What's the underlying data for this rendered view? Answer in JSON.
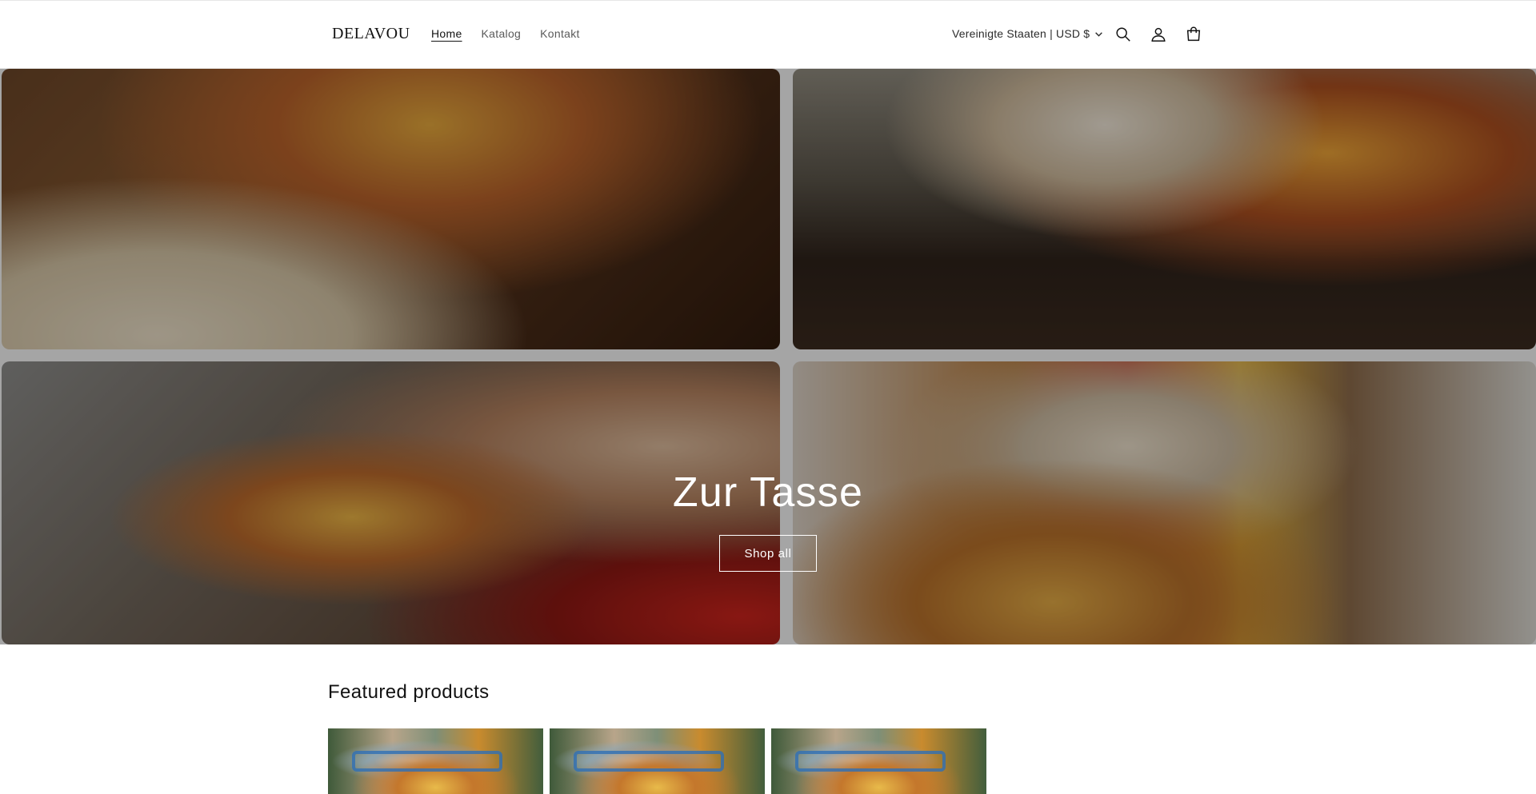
{
  "header": {
    "logo": "DELAVOU",
    "nav": [
      {
        "label": "Home",
        "active": true
      },
      {
        "label": "Katalog",
        "active": false
      },
      {
        "label": "Kontakt",
        "active": false
      }
    ],
    "country_selector": "Vereinigte Staaten | USD $",
    "icons": [
      "search-icon",
      "account-icon",
      "cart-icon"
    ]
  },
  "hero": {
    "title": "Zur Tasse",
    "button_label": "Shop all",
    "images": [
      "hero-image-desk-mug",
      "hero-image-shelf-mug",
      "hero-image-flowers-mug",
      "hero-image-bookshelf-mug"
    ]
  },
  "featured": {
    "title": "Featured products",
    "products": [
      {
        "image": "product-image-book-mug"
      },
      {
        "image": "product-image-book-mug"
      },
      {
        "image": "product-image-book-mug"
      }
    ]
  },
  "colors": {
    "text": "#121212",
    "nav_muted": "#5a5a5a",
    "background": "#ffffff",
    "hero_overlay": "rgba(0,0,0,0.32)"
  }
}
